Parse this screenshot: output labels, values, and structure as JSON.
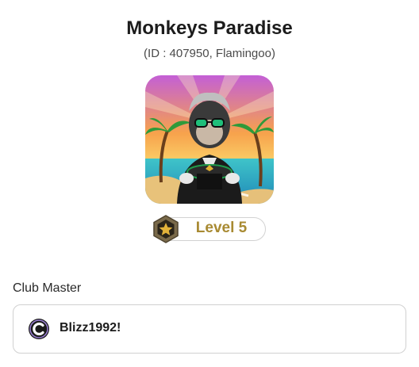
{
  "club": {
    "name": "Monkeys Paradise",
    "subtitle": "(ID : 407950, Flamingoo)",
    "avatar_icon": "monkey-dj-avatar"
  },
  "level": {
    "label": "Level 5",
    "badge_icon": "star-hexagon-icon",
    "accent_color": "#a88a32"
  },
  "master": {
    "section_label": "Club Master",
    "name": "Blizz1992!",
    "icon": "c-logo-icon"
  }
}
